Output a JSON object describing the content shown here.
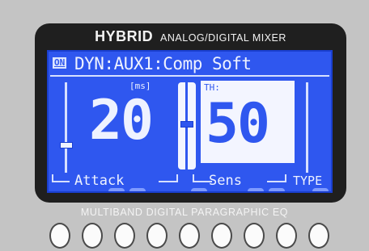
{
  "bezel": {
    "brand": "HYBRID",
    "subtitle": "ANALOG/DIGITAL MIXER"
  },
  "lcd": {
    "on_badge": "ON",
    "header": "DYN:AUX1:Comp Soft",
    "attack": {
      "unit": "[ms]",
      "value": "20",
      "label": "Attack"
    },
    "sens": {
      "unit": "TH: ",
      "value": "50",
      "label": "Sens"
    },
    "type_label": "TYPE"
  },
  "eq_label": "MULTIBAND DIGITAL PARAGRAPHIC EQ",
  "buttons_count": 9,
  "colors": {
    "lcd_background": "#2f57ef",
    "lcd_text": "#eef2ff",
    "bezel": "#1f1f1f",
    "panel": "#c4c4c4"
  }
}
